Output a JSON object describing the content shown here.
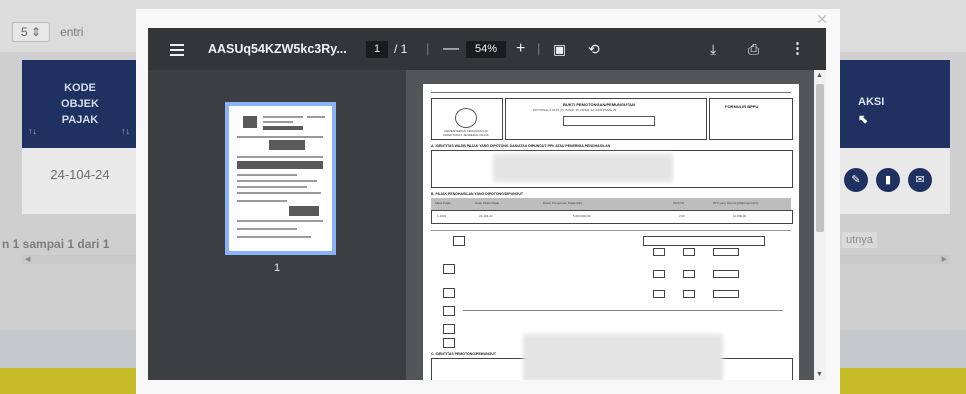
{
  "background": {
    "entries_count": "5",
    "entries_label": "entri",
    "header_left_label": "KODE OBJEK PAJAK",
    "header_right_label": "AKSI",
    "row_code": "24-104-24",
    "page_info": "n 1 sampai 1 dari 1",
    "next_link": "utnya"
  },
  "viewer": {
    "doc_title": "AASUq54KZW5kc3Ry...",
    "current_page": "1",
    "total_pages": "/ 1",
    "zoom": "54%",
    "thumbnail_label": "1"
  },
  "document": {
    "logo_label": "KEMENTERIAN KEUANGAN RI DIREKTORAT JENDERAL PAJAK",
    "title_main": "BUKTI PEMOTONGAN/PEMUNGUTAN",
    "title_sub": "PPh PASAL 4 AYAT (2), PASAL 15, PASAL 22, DAN PASAL 23",
    "form_label": "FORMULIR BPPU",
    "section_a": "A. IDENTITAS WAJIB PAJAK YANG DIPOTONG DAN/ATAU DIPUNGUT PPh ATAU PENERIMA PENGHASILAN",
    "section_b": "B. PAJAK PENGHASILAN YANG DIPOTONG/DIPUNGUT",
    "section_c": "C. IDENTITAS PEMOTONG/PEMUNGUT",
    "col_headers": [
      "Masa Pajak",
      "Kode Objek Pajak",
      "Dasar Pengenaan Pajak (Rp)",
      "Tarif (%)",
      "PPh yang Dipotong/Dipungut (Rp)"
    ],
    "row_values": [
      "1-2022",
      "24-104-24",
      "5.000.000,00",
      "2,00",
      "10.000,00"
    ]
  },
  "colors": {
    "header_navy": "#1f3160",
    "toolbar": "#323639",
    "viewer_bg": "#525659",
    "sidebar_bg": "#3c3f42",
    "thumb_outline": "#8ab4f8",
    "yellow_band": "#c8bb2a"
  }
}
